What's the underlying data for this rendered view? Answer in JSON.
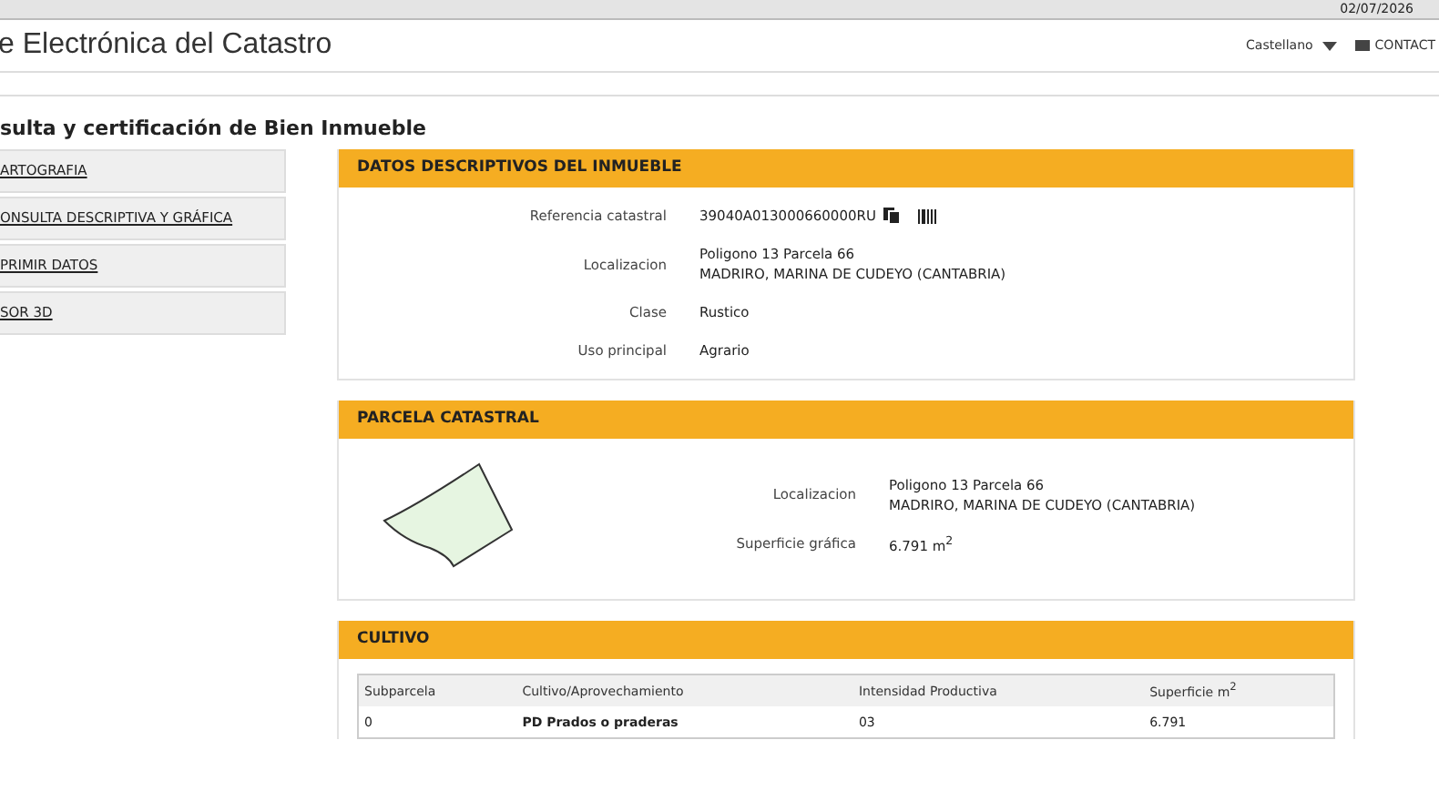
{
  "top_bar": {
    "date": "02/07/2026"
  },
  "header": {
    "title": "e Electrónica del Catastro",
    "language": "Castellano",
    "contact": "CONTACT"
  },
  "page_title": "sulta y certificación de Bien Inmueble",
  "sidebar": {
    "items": [
      {
        "label": "ARTOGRAFIA"
      },
      {
        "label": "ONSULTA DESCRIPTIVA Y GRÁFICA"
      },
      {
        "label": "PRIMIR DATOS"
      },
      {
        "label": "SOR 3D"
      }
    ]
  },
  "datos": {
    "title": "DATOS DESCRIPTIVOS DEL INMUEBLE",
    "rows": [
      {
        "label": "Referencia catastral",
        "lines": [
          "39040A013000660000RU"
        ],
        "kind": "reference"
      },
      {
        "label": "Localizacion",
        "lines": [
          "Poligono 13 Parcela 66",
          "MADRIRO, MARINA DE CUDEYO (CANTABRIA)"
        ],
        "kind": "text"
      },
      {
        "label": "Clase",
        "lines": [
          "Rustico"
        ],
        "kind": "text"
      },
      {
        "label": "Uso principal",
        "lines": [
          "Agrario"
        ],
        "kind": "text"
      }
    ]
  },
  "parcela": {
    "title": "PARCELA CATASTRAL",
    "rows": [
      {
        "label": "Localizacion",
        "lines": [
          "Poligono 13 Parcela 66",
          "MADRIRO, MARINA DE CUDEYO (CANTABRIA)"
        ]
      },
      {
        "label": "Superficie gráfica",
        "lines": [
          "6.791 m$^{2}$"
        ]
      }
    ]
  },
  "cultivo": {
    "title": "CULTIVO",
    "columns": [
      "Subparcela",
      "Cultivo/Aprovechamiento",
      "Intensidad Productiva",
      "Superficie m$^{2}$"
    ],
    "rows": [
      [
        "0",
        "PD Prados o praderas",
        "03",
        "6.791"
      ]
    ]
  }
}
